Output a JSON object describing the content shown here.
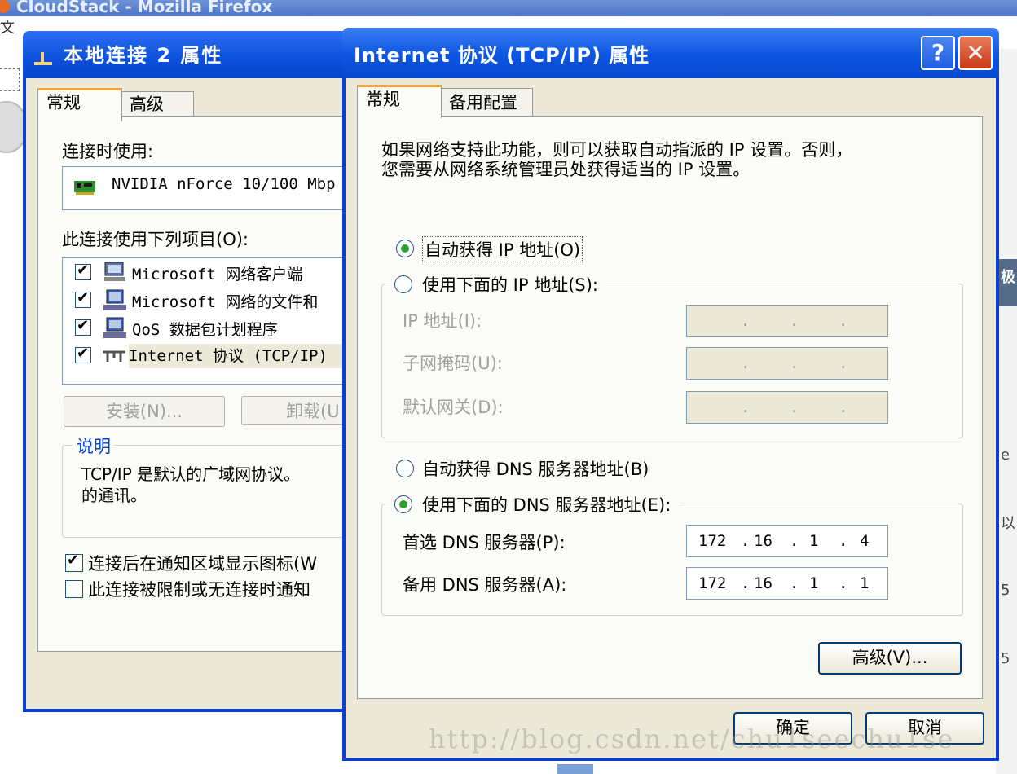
{
  "background": {
    "window_title": "CloudStack - Mozilla Firefox",
    "menu_fragment": "文",
    "right_fragments": [
      "极",
      "e",
      "以",
      "5",
      "5"
    ]
  },
  "local_connection_dialog": {
    "title": "本地连接 2 属性",
    "tabs": [
      "常规",
      "高级"
    ],
    "connect_using_label": "连接时使用:",
    "adapter_name": "NVIDIA nForce 10/100 Mbp",
    "items_label": "此连接使用下列项目(O):",
    "items": [
      {
        "label": "Microsoft 网络客户端",
        "checked": true
      },
      {
        "label": "Microsoft 网络的文件和",
        "checked": true
      },
      {
        "label": "QoS 数据包计划程序",
        "checked": true
      },
      {
        "label": "Internet 协议 (TCP/IP)",
        "checked": true
      }
    ],
    "install_button": "安装(N)...",
    "uninstall_button": "卸载(U",
    "description_title": "说明",
    "description_text": "TCP/IP 是默认的广域网协议。",
    "description_text2": "的通讯。",
    "show_icon_label": "连接后在通知区域显示图标(W",
    "show_icon_checked": true,
    "notify_label": "此连接被限制或无连接时通知",
    "notify_checked": false
  },
  "tcpip_dialog": {
    "title": "Internet 协议 (TCP/IP) 属性",
    "help_button": "?",
    "close_button": "✕",
    "tabs": [
      "常规",
      "备用配置"
    ],
    "intro_line1": "如果网络支持此功能，则可以获取自动指派的 IP 设置。否则，",
    "intro_line2": "您需要从网络系统管理员处获得适当的 IP 设置。",
    "auto_ip_label": "自动获得 IP 地址(O)",
    "auto_ip_selected": true,
    "manual_ip_label": "使用下面的 IP 地址(S):",
    "manual_ip_selected": false,
    "ip_address_label": "IP 地址(I):",
    "subnet_mask_label": "子网掩码(U):",
    "gateway_label": "默认网关(D):",
    "auto_dns_label": "自动获得 DNS 服务器地址(B)",
    "auto_dns_selected": false,
    "manual_dns_label": "使用下面的 DNS 服务器地址(E):",
    "manual_dns_selected": true,
    "preferred_dns_label": "首选 DNS 服务器(P):",
    "preferred_dns": [
      "172",
      "16",
      "1",
      "4"
    ],
    "alternate_dns_label": "备用 DNS 服务器(A):",
    "alternate_dns": [
      "172",
      "16",
      "1",
      "1"
    ],
    "advanced_button": "高级(V)...",
    "ok_button": "确定",
    "cancel_button": "取消"
  },
  "watermark": "http://blog.csdn.net/chu1seechu1se"
}
